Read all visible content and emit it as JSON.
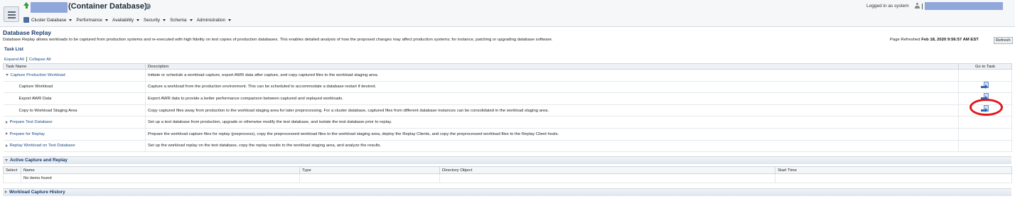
{
  "header": {
    "target_title": "(Container Database)",
    "nav": [
      "Cluster Database",
      "Performance",
      "Availability",
      "Security",
      "Schema",
      "Administration"
    ],
    "login_text": "Logged in as system"
  },
  "page": {
    "title": "Database Replay",
    "intro": "Database Replay allows workloads to be captured from production systems and re-executed with high fidelity on test copies of production databases. This enables detailed analysis of how the proposed changes may affect production systems; for instance, patching or upgrading database software.",
    "refreshed_label": "Page Refreshed",
    "refreshed_value": "Feb 18, 2020 9:56:57 AM EST",
    "refresh_button": "Refresh"
  },
  "task_list": {
    "tab_label": "Task List",
    "expand_all": "Expand All",
    "collapse_all": "Collapse All",
    "columns": [
      "Task Name",
      "Description",
      "Go to Task"
    ],
    "rows": [
      {
        "name": "Capture Production Workload",
        "desc": "Initiate or schedule a workload capture, export AWR data after capture, and copy captured files to the workload staging area."
      },
      {
        "name": "Capture Workload",
        "desc": "Capture a workload from the production environment. This can be scheduled to accommodate a database restart if desired."
      },
      {
        "name": "Export AWR Data",
        "desc": "Export AWR data to provide a better performance comparison between captured and replayed workloads."
      },
      {
        "name": "Copy to Workload Staging Area",
        "desc": "Copy captured files away from production to the workload staging area for later preprocessing. For a cluster database, captured files from different database instances can be consolidated in the workload staging area."
      },
      {
        "name": "Prepare Test Database",
        "desc": "Set up a test database from production, upgrade or otherwise modify the test database, and isolate the test database prior to replay."
      },
      {
        "name": "Prepare for Replay",
        "desc": "Prepare the workload capture files for replay (preprocess), copy the preprocessed workload files to the workload staging area, deploy the Replay Clients, and copy the preprocessed workload files to the Replay Client hosts."
      },
      {
        "name": "Replay Workload on Test Database",
        "desc": "Set up the workload replay on the test database, copy the replay results to the workload staging area, and analyze the results."
      }
    ]
  },
  "active_capture": {
    "title": "Active Capture and Replay",
    "columns": [
      "Select",
      "Name",
      "Type",
      "Directory Object",
      "Start Time"
    ],
    "empty_text": "No items found"
  },
  "history": {
    "title": "Workload Capture History"
  }
}
